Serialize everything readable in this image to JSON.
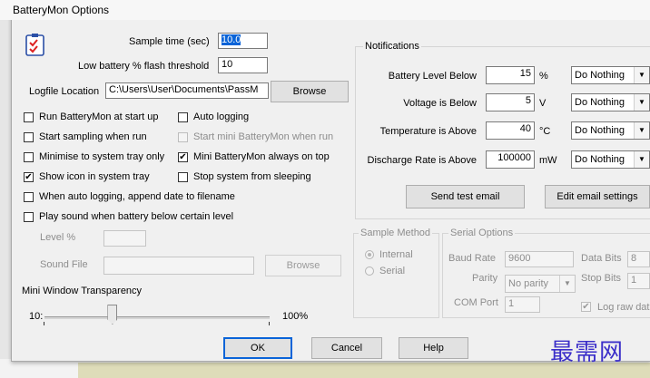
{
  "window": {
    "title": "BatteryMon Options"
  },
  "general": {
    "sample_time_label": "Sample time (sec)",
    "sample_time_value": "10.0",
    "low_battery_label": "Low battery % flash threshold",
    "low_battery_value": "10",
    "logfile_label": "Logfile Location",
    "logfile_value": "C:\\Users\\User\\Documents\\PassM",
    "browse_label": "Browse",
    "options": [
      {
        "label": "Run BatteryMon at start up",
        "checked": false,
        "enabled": true
      },
      {
        "label": "Auto logging",
        "checked": false,
        "enabled": true
      },
      {
        "label": "Start sampling when run",
        "checked": false,
        "enabled": true
      },
      {
        "label": "Start mini BatteryMon when run",
        "checked": false,
        "enabled": false
      },
      {
        "label": "Minimise to system tray only",
        "checked": false,
        "enabled": true
      },
      {
        "label": "Mini BatteryMon always on top",
        "checked": true,
        "enabled": true
      },
      {
        "label": "Show icon in system tray",
        "checked": true,
        "enabled": true
      },
      {
        "label": "Stop system from sleeping",
        "checked": false,
        "enabled": true
      },
      {
        "label": "When auto logging, append date to filename",
        "checked": false,
        "enabled": true
      },
      {
        "label": "Play sound when battery below certain level",
        "checked": false,
        "enabled": true
      }
    ],
    "level_label": "Level %",
    "sound_file_label": "Sound File",
    "sound_browse_label": "Browse"
  },
  "transparency": {
    "label": "Mini Window Transparency",
    "min_label": "10:",
    "max_label": "100%",
    "value_fraction": 0.3
  },
  "notifications": {
    "group_title": "Notifications",
    "rows": [
      {
        "label": "Battery Level Below",
        "value": "15",
        "unit": "%",
        "action": "Do Nothing"
      },
      {
        "label": "Voltage is Below",
        "value": "5",
        "unit": "V",
        "action": "Do Nothing"
      },
      {
        "label": "Temperature is Above",
        "value": "40",
        "unit": "°C",
        "action": "Do Nothing"
      },
      {
        "label": "Discharge Rate is Above",
        "value": "100000",
        "unit": "mW",
        "action": "Do Nothing"
      }
    ],
    "send_test_label": "Send test email",
    "edit_email_label": "Edit email settings"
  },
  "sample_method": {
    "group_title": "Sample Method",
    "internal_label": "Internal",
    "serial_label": "Serial"
  },
  "serial": {
    "group_title": "Serial Options",
    "baud_label": "Baud Rate",
    "baud_value": "9600",
    "parity_label": "Parity",
    "parity_value": "No parity",
    "com_label": "COM Port",
    "com_value": "1",
    "data_bits_label": "Data Bits",
    "data_bits_value": "8",
    "stop_bits_label": "Stop Bits",
    "stop_bits_value": "1",
    "log_raw_label": "Log raw dat"
  },
  "footer": {
    "ok": "OK",
    "cancel": "Cancel",
    "help": "Help"
  },
  "watermark": "最需网"
}
